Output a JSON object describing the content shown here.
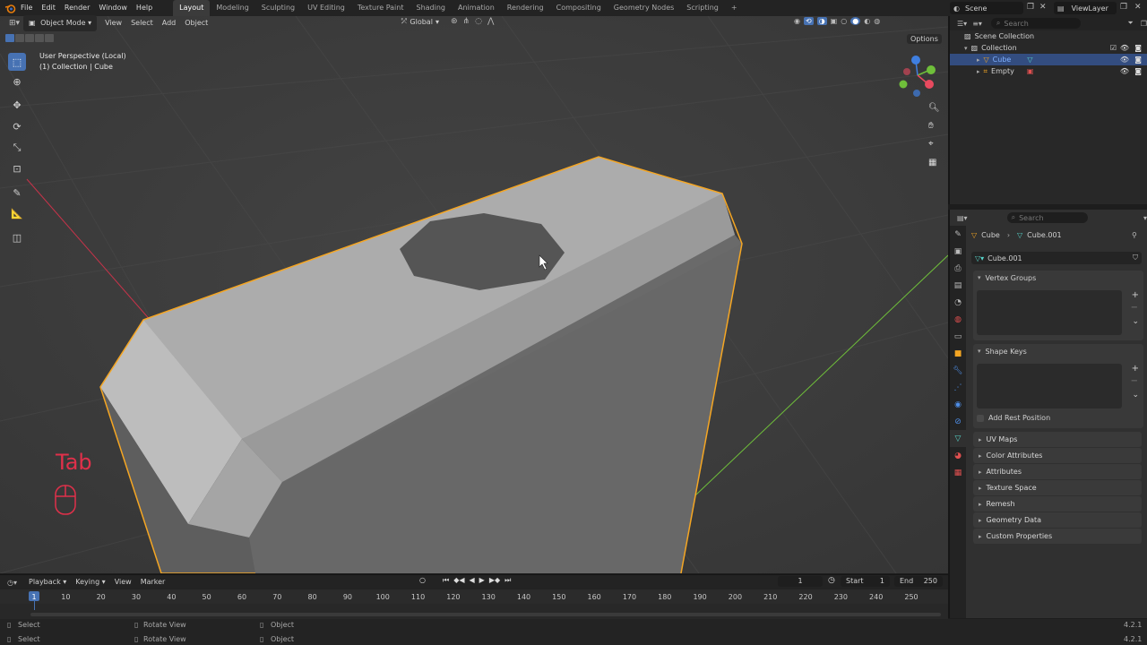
{
  "menubar": {
    "items": [
      "File",
      "Edit",
      "Render",
      "Window",
      "Help"
    ],
    "workspaces": [
      "Layout",
      "Modeling",
      "Sculpting",
      "UV Editing",
      "Texture Paint",
      "Shading",
      "Animation",
      "Rendering",
      "Compositing",
      "Geometry Nodes",
      "Scripting"
    ],
    "active_workspace": "Layout",
    "add_tab": "+",
    "scene": "Scene",
    "view_layer": "ViewLayer"
  },
  "viewport_header": {
    "mode": "Object Mode",
    "menus": [
      "View",
      "Select",
      "Add",
      "Object"
    ],
    "orientation": "Global",
    "options": "Options"
  },
  "viewport": {
    "perspective": "User Perspective (Local)",
    "collection_path": "(1) Collection | Cube",
    "key_overlay": "Tab",
    "gizmo_axes": [
      "X",
      "Y",
      "Z"
    ]
  },
  "outliner": {
    "search_placeholder": "Search",
    "root": "Scene Collection",
    "collection": "Collection",
    "items": [
      {
        "name": "Cube",
        "selected": true
      },
      {
        "name": "Empty",
        "selected": false
      }
    ]
  },
  "properties": {
    "search_placeholder": "Search",
    "breadcrumb_object": "Cube",
    "breadcrumb_mesh": "Cube.001",
    "datablock": "Cube.001",
    "vertex_groups": "Vertex Groups",
    "shape_keys": "Shape Keys",
    "add_rest_position": "Add Rest Position",
    "panels": [
      "UV Maps",
      "Color Attributes",
      "Attributes",
      "Texture Space",
      "Remesh",
      "Geometry Data",
      "Custom Properties"
    ]
  },
  "timeline": {
    "menus": [
      "Playback",
      "Keying",
      "View",
      "Marker"
    ],
    "current_frame": "1",
    "start_label": "Start",
    "start": "1",
    "end_label": "End",
    "end": "250",
    "ticks": [
      "1",
      "10",
      "20",
      "30",
      "40",
      "50",
      "60",
      "70",
      "80",
      "90",
      "100",
      "110",
      "120",
      "130",
      "140",
      "150",
      "160",
      "170",
      "180",
      "190",
      "200",
      "210",
      "220",
      "230",
      "240",
      "250"
    ]
  },
  "statusbar": {
    "row1": [
      "Select",
      "Rotate View",
      "Object"
    ],
    "row2": [
      "Select",
      "Rotate View",
      "Object"
    ],
    "version": "4.2.1"
  },
  "colors": {
    "accent": "#4772b3",
    "selection_outline": "#f5a623",
    "key_overlay": "#e0304a",
    "x_axis": "#e84a5f",
    "y_axis": "#6fbf3a",
    "z_axis": "#3f7fe0"
  }
}
